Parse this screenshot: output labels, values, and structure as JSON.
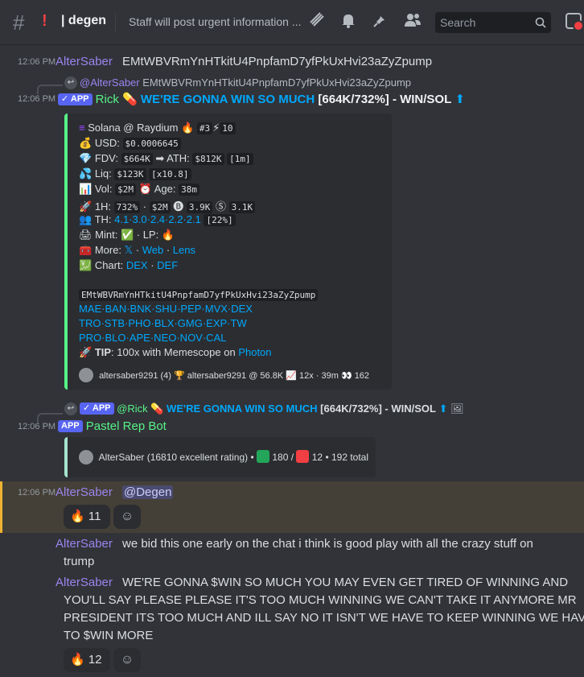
{
  "header": {
    "channel_prefix": "!",
    "channel_name": "| degen",
    "topic": "Staff will post urgent information ...",
    "search_placeholder": "Search"
  },
  "messages": {
    "m1": {
      "time": "12:06 PM",
      "author": "AlterSaber",
      "text": "EMtWBVRmYnHTkitU4PnpfamD7yfPkUxHvi23aZyZpump"
    },
    "m2": {
      "reply_author": "@AlterSaber",
      "reply_text": "EMtWBVRmYnHTkitU4PnpfamD7yfPkUxHvi23aZyZpump",
      "time": "12:06 PM",
      "badge": "APP",
      "author": "Rick",
      "headline": "WE'RE GONNA WIN SO MUCH",
      "stats": "[664K/732%] - WIN/SOL",
      "embed": {
        "l1_label": "Solana @ Raydium",
        "l1_rank": "#3",
        "l1_num": "10",
        "usd_label": "USD:",
        "usd_val": "$0.0006645",
        "fdv_label": "FDV:",
        "fdv_val": "$664K",
        "ath_label": "ATH:",
        "ath_val": "$812K",
        "ath_time": "[1m]",
        "liq_label": "Liq:",
        "liq_val": "$123K",
        "liq_mult": "[x10.8]",
        "vol_label": "Vol:",
        "vol_val": "$2M",
        "age_label": "Age:",
        "age_val": "38m",
        "h1_label": "1H:",
        "h1_pct": "732%",
        "h1_vol": "$2M",
        "h1_buys": "3.9K",
        "h1_sells": "3.1K",
        "th_label": "TH:",
        "th_vals": "4.1·3.0·2.4·2.2·2.1",
        "th_total": "[22%]",
        "mint_label": "Mint:",
        "lp_label": "· LP:",
        "more_label": "More:",
        "more_x": "𝕏",
        "more_web": "Web",
        "more_lens": "Lens",
        "chart_label": "Chart:",
        "chart_dex": "DEX",
        "chart_def": "DEF",
        "ca": "EMtWBVRmYnHTkitU4PnpfamD7yfPkUxHvi23aZyZpump",
        "links1": "MAE·BAN·BNK·SHU·PEP·MVX·DEX",
        "links2": "TRO·STB·PHO·BLX·GMG·EXP·TW",
        "links3": "PRO·BLO·APE·NEO·NOV·CAL",
        "tip_label": "TIP",
        "tip_text": ": 100x with Memescope on",
        "tip_link": "Photon",
        "footer": "altersaber9291 (4) 🏆 altersaber9291 @ 56.8K 📈 12x · 39m 👀 162"
      }
    },
    "m3": {
      "reply_badge": "APP",
      "reply_author": "@Rick",
      "reply_headline": "WE'RE GONNA WIN SO MUCH",
      "reply_stats": "[664K/732%] - WIN/SOL",
      "time": "12:06 PM",
      "badge": "APP",
      "author": "Pastel Rep Bot",
      "embed_text_a": "AlterSaber (16810 excellent rating) •",
      "embed_pos": "180 /",
      "embed_neg": "12",
      "embed_total": "• 192 total"
    },
    "m4": {
      "time": "12:06 PM",
      "author": "AlterSaber",
      "mention": "@Degen",
      "reaction_count": "11"
    },
    "m5": {
      "author": "AlterSaber",
      "text_l1": "we bid this one early on the chat i think is good play with  all the crazy stuff on",
      "text_l2": "trump"
    },
    "m6": {
      "author": "AlterSaber",
      "text_l1": "WE'RE GONNA $WIN SO MUCH YOU MAY EVEN GET TIRED OF WINNING AND",
      "text_l2": "YOU'LL SAY PLEASE PLEASE IT'S TOO MUCH WINNING WE CAN'T TAKE IT ANYMORE MR",
      "text_l3": "PRESIDENT ITS TOO MUCH AND ILL SAY NO IT ISN'T WE HAVE TO KEEP WINNING WE HAVE",
      "text_l4": "TO $WIN MORE",
      "reaction_count": "12"
    }
  },
  "colors": {
    "altersaber": "#9c84ef",
    "rick": "#57f287",
    "pastel": "#57f287",
    "embed_border": "#57f287",
    "link": "#00a8fc",
    "highlight": "#f0b232"
  }
}
